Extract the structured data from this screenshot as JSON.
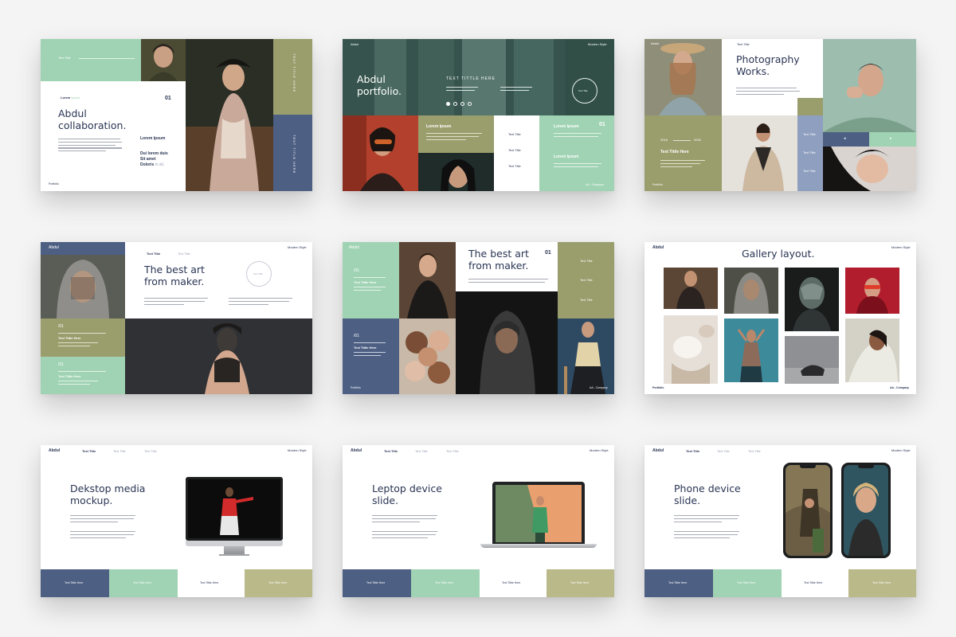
{
  "colors": {
    "mint": "#9fd3b3",
    "olive": "#9a9d6c",
    "olive_light": "#b9b989",
    "navy": "#4d5f83",
    "periwinkle": "#8f9fbf",
    "dark_text": "#2a3554",
    "background": "#f4f4f4"
  },
  "slide1": {
    "header_label": "Text Title",
    "lorem_label": "Lorem",
    "lorem_label_light": "Ipsum",
    "number": "01",
    "title": "Abdul collaboration.",
    "side_title": "Lorem Ipsum",
    "side_bold_1": "Dui lorem duis",
    "side_bold_2": "Sit amet",
    "side_bold_3": "Doloris",
    "side_bold_suffix": "in sit.",
    "vertical_1": "TEXT TITLE HERE",
    "vertical_2": "TEXT TITLE HERE",
    "footer": "Portfolio"
  },
  "slide2": {
    "brand": "Abdul",
    "tag": "Modern Style",
    "title": "Abdul portfolio.",
    "tagline": "TEXT TITTLE HERE",
    "circle_label": "Text Title",
    "panel_title": "Lorem Ipsum",
    "items": [
      "Text Title",
      "Text Title",
      "Text Title"
    ],
    "number": "01",
    "label_a": "Lorem Ipsum",
    "label_b": "Lorem Ipsum",
    "footer": "AA - Company"
  },
  "slide3": {
    "brand": "Abdul",
    "header": "Text Title",
    "title": "Photography Works.",
    "year_start": "2018",
    "year_end": "2020",
    "caption": "Text Tittle Here",
    "tabs": [
      "Text Title",
      "Text Title",
      "Text Title"
    ],
    "footer": "Portfolio"
  },
  "slide4": {
    "brand": "Abdul",
    "nav": [
      "Text Title",
      "Text Title"
    ],
    "tag": "Modern Style",
    "title": "The best art from maker.",
    "circle_label": "Text Title",
    "index_1": "/01",
    "caption_1": "Text Tittle Here",
    "index_2": "/01",
    "caption_2": "Text Tittle Here"
  },
  "slide5": {
    "brand": "Abdul",
    "index_1": "/01",
    "caption_1": "Text Tittle Here",
    "index_2": "/01",
    "caption_2": "Text Tittle Here",
    "title": "The best art from maker.",
    "number": "01",
    "side_items": [
      "Text Title",
      "Text Title",
      "Text Title"
    ],
    "footer_left": "Portfolio",
    "footer_right": "AA - Company"
  },
  "slide6": {
    "brand": "Abdul",
    "title": "Gallery layout.",
    "tag": "Modern Style",
    "footer_left": "Portfolio",
    "footer_right": "AA - Company"
  },
  "slide7": {
    "brand": "Abdul",
    "nav": [
      "Text Title",
      "Text Title",
      "Text Title"
    ],
    "tag": "Modern Style",
    "title": "Dekstop media mockup.",
    "footer_blocks": [
      "Text Tittle Here",
      "Text Tittle Here",
      "Text Tittle Here",
      "Text Tittle Here"
    ]
  },
  "slide8": {
    "brand": "Abdul",
    "nav": [
      "Text Title",
      "Text Title",
      "Text Title"
    ],
    "tag": "Modern Style",
    "title": "Leptop device slide.",
    "footer_blocks": [
      "Text Tittle Here",
      "Text Tittle Here",
      "Text Tittle Here",
      "Text Tittle Here"
    ]
  },
  "slide9": {
    "brand": "Abdul",
    "nav": [
      "Text Title",
      "Text Title",
      "Text Title"
    ],
    "tag": "Modern Style",
    "title": "Phone device slide.",
    "footer_blocks": [
      "Text Tittle Here",
      "Text Tittle Here",
      "Text Tittle Here",
      "Text Tittle Here"
    ]
  }
}
